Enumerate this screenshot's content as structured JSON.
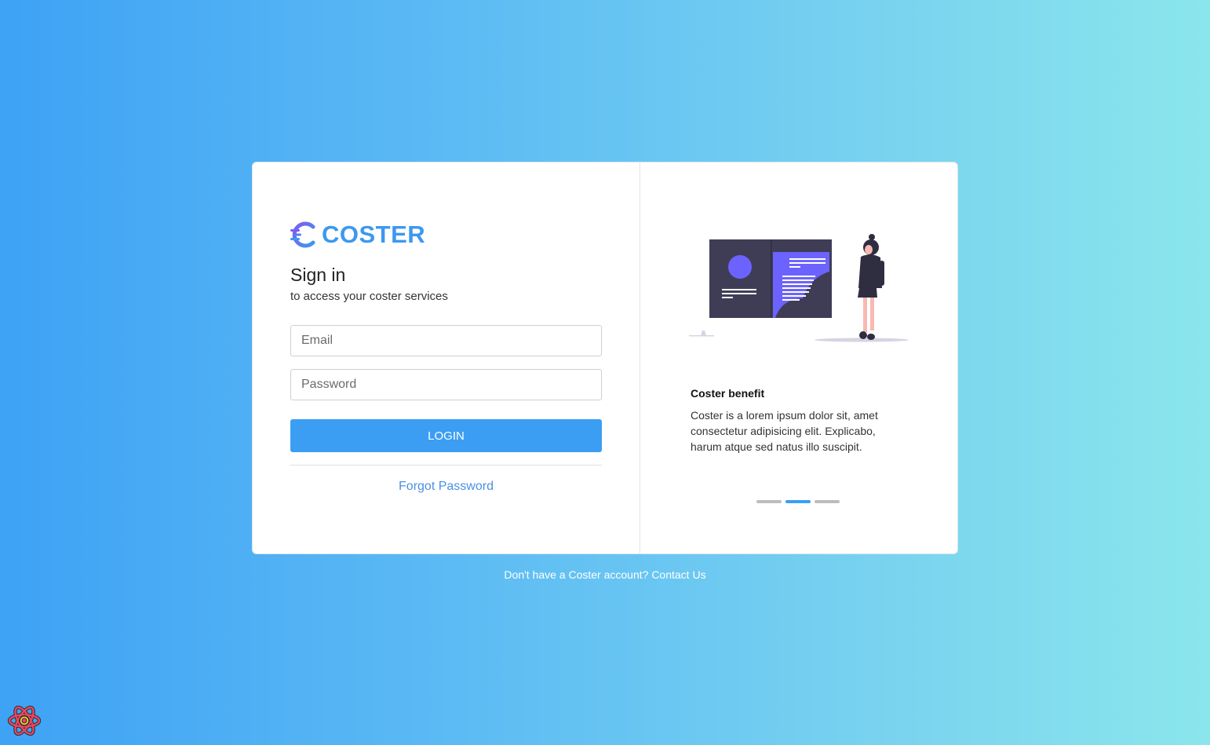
{
  "brand": {
    "name": "COSTER",
    "logo_icon": "coster-logo-icon",
    "accent": "#3d98ef"
  },
  "signin": {
    "title": "Sign in",
    "subtitle": "to access your coster services",
    "email_placeholder": "Email",
    "email_value": "",
    "password_placeholder": "Password",
    "password_value": "",
    "login_label": "LOGIN",
    "forgot_label": "Forgot Password"
  },
  "carousel": {
    "illustration_icon": "presentation-illustration",
    "heading": "Coster benefit",
    "text": "Coster is a lorem ipsum dolor sit, amet consectetur adipisicing elit. Explicabo, harum atque sed natus illo suscipit.",
    "slide_count": 3,
    "active_slide": 2
  },
  "footer": {
    "contact_text": "Don't have a Coster account? Contact Us"
  },
  "devtools": {
    "icon": "react-devtools-icon"
  },
  "colors": {
    "primary": "#3b9ef3",
    "link": "#4a90e2",
    "gradient_start": "#3ea2f5",
    "gradient_end": "#8ae6ec"
  }
}
